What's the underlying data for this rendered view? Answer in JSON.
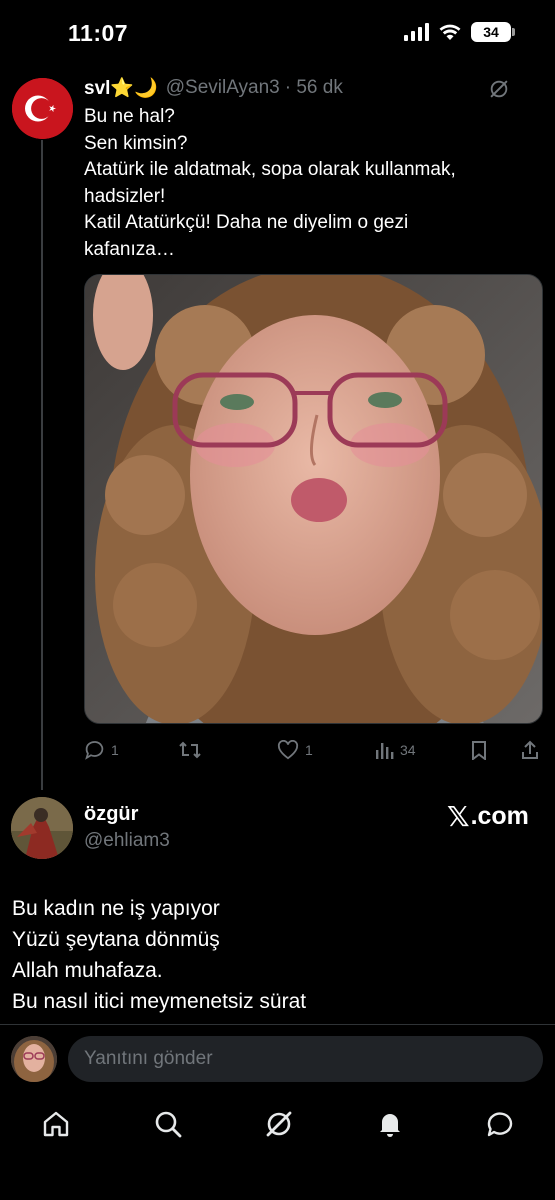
{
  "status_bar": {
    "time": "11:07",
    "battery": "34"
  },
  "quoted_tweet": {
    "name": "svl⭐🌙",
    "handle": "@SevilAyan3",
    "time_ago": "· 56 dk",
    "text_lines": [
      "Bu ne hal?",
      "Sen kimsin?",
      "Atatürk ile aldatmak, sopa olarak kullanmak,",
      "hadsizler!",
      "Katil Atatürkçü! Daha ne diyelim o gezi",
      "kafanıza…"
    ],
    "actions": {
      "replies": "1",
      "reposts": "",
      "likes": "1",
      "views": "34"
    }
  },
  "main_tweet": {
    "name": "özgür",
    "handle": "@ehliam3",
    "watermark": "X.com",
    "watermark_rest": ".com",
    "text_lines": [
      "Bu kadın ne iş yapıyor",
      "Yüzü şeytana dönmüş",
      "Allah muhafaza.",
      "Bu nasıl itici meymenetsiz sürat"
    ]
  },
  "reply_bar": {
    "placeholder": "Yanıtını gönder"
  },
  "bottom_nav": [
    "home-icon",
    "search-icon",
    "grok-icon",
    "notifications-icon",
    "messages-icon"
  ],
  "colors": {
    "background": "#000000",
    "secondary_text": "#71767b",
    "input_background": "#202327",
    "flag_red": "#c9151e"
  }
}
